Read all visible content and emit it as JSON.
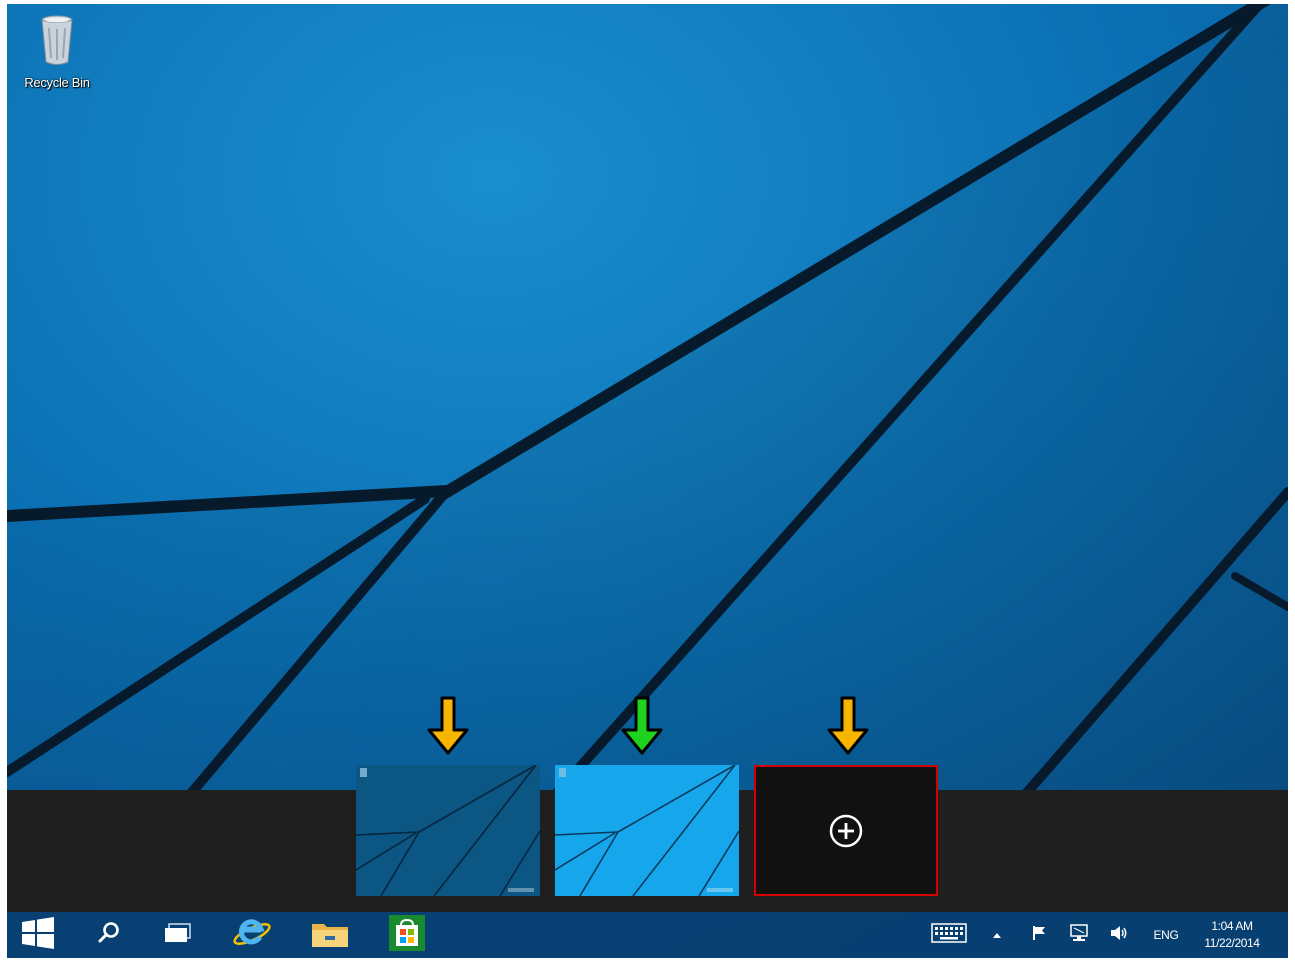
{
  "desktop": {
    "icons": [
      {
        "label": "Recycle Bin",
        "icon": "recycle-bin-icon"
      }
    ]
  },
  "task_view": {
    "desktops": [
      {
        "name": "",
        "state": "inactive",
        "marker": "yellow-down-arrow"
      },
      {
        "name": "",
        "state": "active",
        "marker": "green-down-arrow"
      }
    ],
    "add_desktop": {
      "icon": "plus-circle-icon",
      "marker": "yellow-down-arrow"
    },
    "colors": {
      "yellow_arrow": "#f7b500",
      "green_arrow": "#1ed21e",
      "add_border": "#d40000",
      "strip_background": "#1f1f1f"
    }
  },
  "taskbar": {
    "buttons": [
      {
        "name": "start",
        "icon": "windows-logo-icon"
      },
      {
        "name": "search",
        "icon": "search-icon"
      },
      {
        "name": "task-view",
        "icon": "task-view-icon"
      },
      {
        "name": "internet-explorer",
        "icon": "ie-icon"
      },
      {
        "name": "file-explorer",
        "icon": "folder-icon"
      },
      {
        "name": "store",
        "icon": "store-icon"
      }
    ],
    "tray": {
      "icons": [
        "touch-keyboard-icon",
        "chevron-up-icon",
        "flag-icon",
        "network-icon",
        "volume-icon"
      ],
      "language": "ENG",
      "time": "1:04 AM",
      "date": "11/22/2014"
    },
    "colors": {
      "background": "#083e70"
    }
  }
}
